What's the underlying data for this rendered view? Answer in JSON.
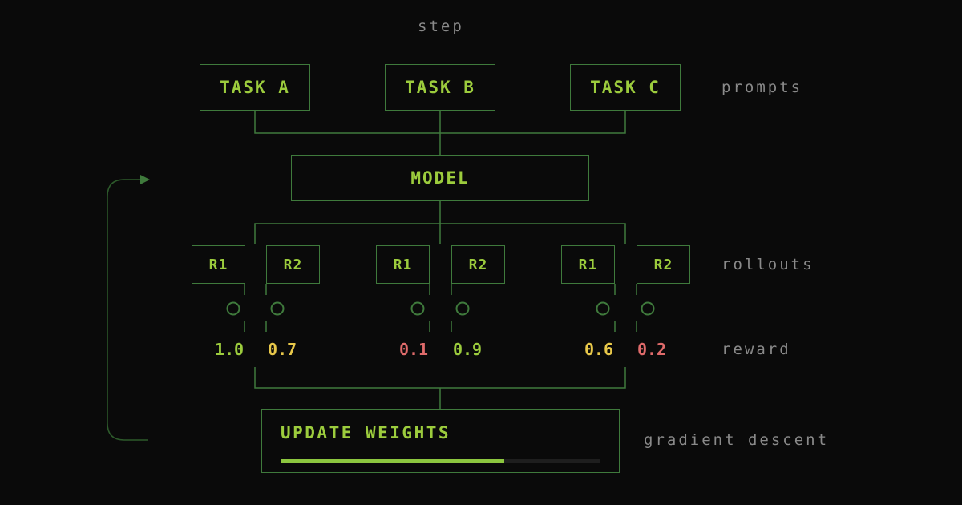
{
  "header": {
    "step_label": "step"
  },
  "tasks": [
    {
      "label": "TASK A"
    },
    {
      "label": "TASK B"
    },
    {
      "label": "TASK C"
    }
  ],
  "model": {
    "label": "MODEL"
  },
  "rollouts": [
    {
      "label": "R1",
      "reward": "1.0",
      "tone": "green"
    },
    {
      "label": "R2",
      "reward": "0.7",
      "tone": "yellow"
    },
    {
      "label": "R1",
      "reward": "0.1",
      "tone": "red"
    },
    {
      "label": "R2",
      "reward": "0.9",
      "tone": "green"
    },
    {
      "label": "R1",
      "reward": "0.6",
      "tone": "yellow"
    },
    {
      "label": "R2",
      "reward": "0.2",
      "tone": "red"
    }
  ],
  "side_labels": {
    "prompts": "prompts",
    "rollouts": "rollouts",
    "reward": "reward",
    "gradient": "gradient descent"
  },
  "update": {
    "label": "UPDATE WEIGHTS",
    "progress": 0.7
  },
  "colors": {
    "accent": "#9ccc3d",
    "border": "#3f7a3c",
    "reward_green": "#9ccc3d",
    "reward_yellow": "#e8c84a",
    "reward_red": "#e06b6b",
    "muted_text": "#8a8a8a",
    "background": "#0a0a0a"
  }
}
